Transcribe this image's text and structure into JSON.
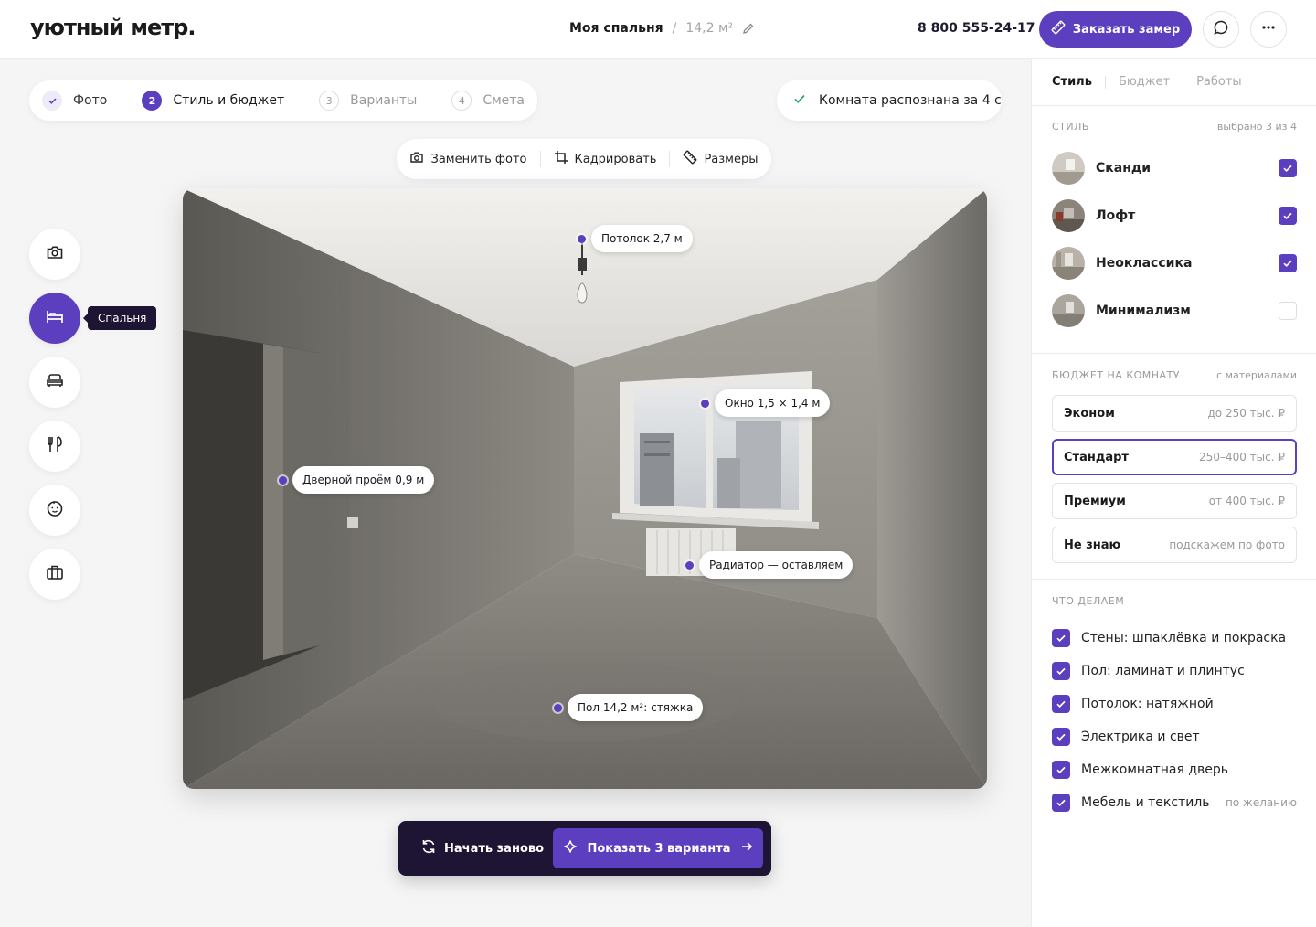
{
  "header": {
    "logo": "уютный метр.",
    "room_name": "Моя спальня",
    "separator": "/",
    "room_area": "14,2 м²",
    "phone": "8 800 555-24-17",
    "order_label": "Заказать замер"
  },
  "stepper": {
    "steps": [
      {
        "num": "✓",
        "label": "Фото",
        "state": "done"
      },
      {
        "num": "2",
        "label": "Стиль и бюджет",
        "state": "active"
      },
      {
        "num": "3",
        "label": "Варианты",
        "state": "pending"
      },
      {
        "num": "4",
        "label": "Смета",
        "state": "pending"
      }
    ]
  },
  "recognition": {
    "text": "Комната распознана за 4 с"
  },
  "toolbar": {
    "replace": "Заменить фото",
    "crop": "Кадрировать",
    "dimensions": "Размеры"
  },
  "rail": {
    "tooltip": "Спальня"
  },
  "annotations": {
    "ceiling": "Потолок 2,7 м",
    "window": "Окно 1,5 × 1,4 м",
    "door": "Дверной проём 0,9 м",
    "radiator": "Радиатор — оставляем",
    "floor": "Пол 14,2 м²: стяжка"
  },
  "actions": {
    "restart": "Начать заново",
    "show": "Показать 3 варианта"
  },
  "panel": {
    "tabs": [
      "Стиль",
      "Бюджет",
      "Работы"
    ],
    "style": {
      "title": "СТИЛЬ",
      "hint": "выбрано 3 из 4",
      "items": [
        {
          "name": "Сканди",
          "checked": true
        },
        {
          "name": "Лофт",
          "checked": true
        },
        {
          "name": "Неоклассика",
          "checked": true
        },
        {
          "name": "Минимализм",
          "checked": false
        }
      ]
    },
    "budget": {
      "title": "БЮДЖЕТ НА КОМНАТУ",
      "hint": "с материалами",
      "options": [
        {
          "name": "Эконом",
          "value": "до 250 тыс. ₽",
          "selected": false
        },
        {
          "name": "Стандарт",
          "value": "250–400 тыс. ₽",
          "selected": true
        },
        {
          "name": "Премиум",
          "value": "от 400 тыс. ₽",
          "selected": false
        },
        {
          "name": "Не знаю",
          "value": "подскажем по фото",
          "selected": false
        }
      ]
    },
    "works": {
      "title": "ЧТО ДЕЛАЕМ",
      "items": [
        {
          "label": "Стены: шпаклёвка и покраска",
          "note": ""
        },
        {
          "label": "Пол: ламинат и плинтус",
          "note": ""
        },
        {
          "label": "Потолок: натяжной",
          "note": ""
        },
        {
          "label": "Электрика и свет",
          "note": ""
        },
        {
          "label": "Межкомнатная дверь",
          "note": ""
        },
        {
          "label": "Мебель и текстиль",
          "note": "по желанию"
        }
      ]
    }
  },
  "colors": {
    "accent": "#5b3fbf",
    "dark": "#1e1433"
  }
}
